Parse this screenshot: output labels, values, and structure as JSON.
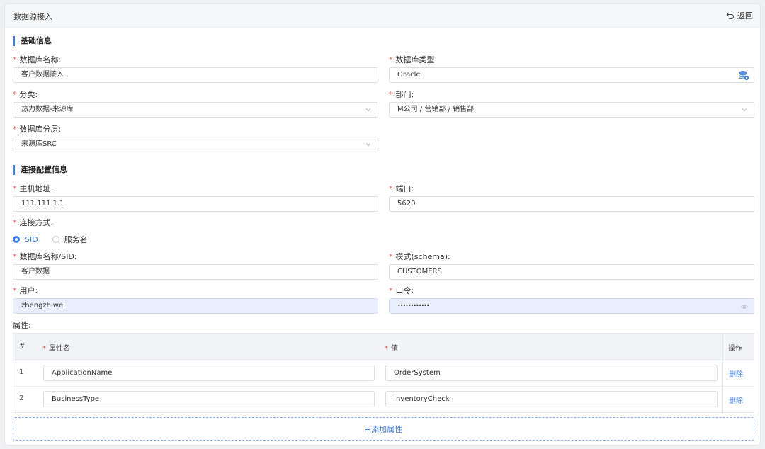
{
  "header": {
    "title": "数据源接入",
    "back_label": "返回"
  },
  "sections": {
    "basic": "基础信息",
    "connection": "连接配置信息"
  },
  "fields": {
    "db_name": {
      "label": "数据库名称:",
      "value": "客户数据接入"
    },
    "db_type": {
      "label": "数据库类型:",
      "value": "Oracle"
    },
    "category": {
      "label": "分类:",
      "value": "热力数据-来源库"
    },
    "department": {
      "label": "部门:",
      "value": "M公司 / 营销部 / 销售部"
    },
    "db_layer": {
      "label": "数据库分层:",
      "value": "来源库SRC"
    },
    "host": {
      "label": "主机地址:",
      "value": "111.111.1.1"
    },
    "port": {
      "label": "端口:",
      "value": "5620"
    },
    "conn_mode": {
      "label": "连接方式:",
      "options": [
        "SID",
        "服务名"
      ],
      "selected": "SID"
    },
    "sid": {
      "label": "数据库名称/SID:",
      "value": "客户数据"
    },
    "schema": {
      "label": "模式(schema):",
      "value": "CUSTOMERS"
    },
    "user": {
      "label": "用户:",
      "value": "zhengzhiwei"
    },
    "password": {
      "label": "口令:",
      "value": "••••••••••••"
    }
  },
  "properties": {
    "label": "属性:",
    "columns": {
      "index": "#",
      "name": "属性名",
      "value": "值",
      "action": "操作"
    },
    "rows": [
      {
        "index": "1",
        "name": "ApplicationName",
        "value": "OrderSystem",
        "action": "删除"
      },
      {
        "index": "2",
        "name": "BusinessType",
        "value": "InventoryCheck",
        "action": "删除"
      }
    ],
    "add_label": "+添加属性"
  },
  "colors": {
    "accent": "#3d7be8",
    "required": "#e45656",
    "filled_bg": "#e8eefb"
  },
  "icons": [
    "return-icon",
    "database-icon",
    "chevron-down-icon",
    "eye-icon"
  ]
}
